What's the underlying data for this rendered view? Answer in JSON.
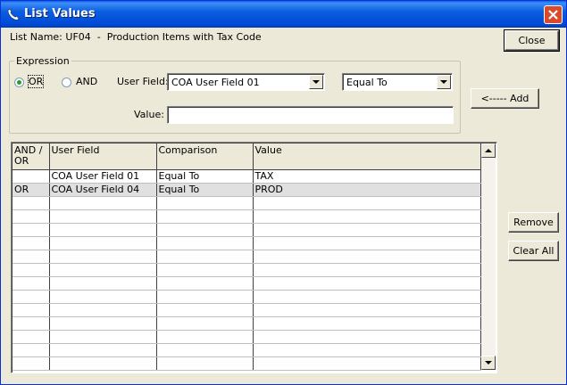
{
  "window": {
    "title": "List Values"
  },
  "list_name": {
    "label": "List Name:",
    "code": "UF04",
    "separator": "-",
    "description": "Production Items with Tax Code"
  },
  "buttons": {
    "close": "Close",
    "add": "<----- Add",
    "remove": "Remove",
    "clear_all": "Clear All"
  },
  "expression": {
    "legend": "Expression",
    "or_label": "OR",
    "and_label": "AND",
    "selected": "OR",
    "user_field_label": "User Field:",
    "user_field_value": "COA User Field 01",
    "comparison_value": "Equal To",
    "value_label": "Value:",
    "value_input": ""
  },
  "grid": {
    "columns": [
      "AND / OR",
      "User Field",
      "Comparison",
      "Value"
    ],
    "rows": [
      [
        "",
        "COA User Field 01",
        "Equal To",
        "TAX"
      ],
      [
        "OR",
        "COA User Field 04",
        "Equal To",
        "PROD"
      ]
    ],
    "selected_row": 1
  },
  "icons": {
    "title": "phone-handset-icon",
    "close": "close-icon"
  },
  "colors": {
    "titlebar": "#0054e3",
    "close_button": "#d9492b",
    "dialog_bg": "#ece9d8"
  }
}
